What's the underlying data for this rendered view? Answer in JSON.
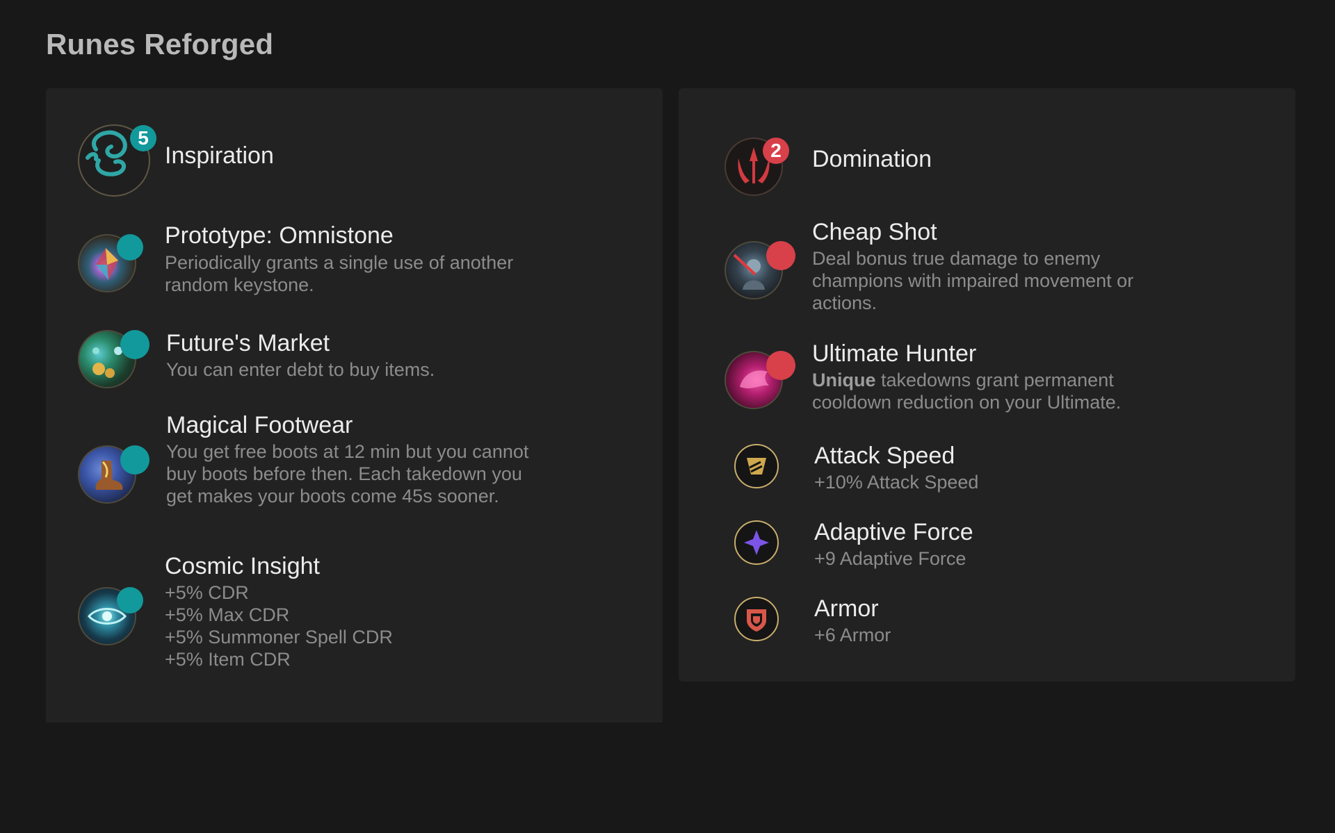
{
  "page": {
    "title": "Runes Reforged"
  },
  "colors": {
    "inspiration": "#12999b",
    "domination": "#d8404a",
    "background": "#181818",
    "panel": "#222222"
  },
  "primary": {
    "tree": {
      "name": "Inspiration",
      "badge": "5",
      "icon": "inspiration-tree-icon"
    },
    "runes": [
      {
        "name": "Prototype: Omnistone",
        "desc": "Periodically grants a single use of another random keystone.",
        "icon": "omnistone-icon"
      },
      {
        "name": "Future's Market",
        "desc": "You can enter debt to buy items.",
        "icon": "futures-market-icon"
      },
      {
        "name": "Magical Footwear",
        "desc": "You get free boots at 12 min but you cannot buy boots before then. Each takedown you get makes your boots come 45s sooner.",
        "icon": "magical-footwear-icon"
      },
      {
        "name": "Cosmic Insight",
        "desc_lines": [
          "+5% CDR",
          "+5% Max CDR",
          "+5% Summoner Spell CDR",
          "+5% Item CDR"
        ],
        "icon": "cosmic-insight-icon"
      }
    ]
  },
  "secondary": {
    "tree": {
      "name": "Domination",
      "badge": "2",
      "icon": "domination-tree-icon"
    },
    "runes": [
      {
        "name": "Cheap Shot",
        "desc": "Deal bonus true damage to enemy champions with impaired movement or actions.",
        "icon": "cheap-shot-icon"
      },
      {
        "name": "Ultimate Hunter",
        "desc_bold": "Unique",
        "desc": " takedowns grant permanent cooldown reduction on your Ultimate.",
        "icon": "ultimate-hunter-icon"
      }
    ],
    "shards": [
      {
        "name": "Attack Speed",
        "desc": "+10% Attack Speed",
        "icon": "attack-speed-icon"
      },
      {
        "name": "Adaptive Force",
        "desc": "+9 Adaptive Force",
        "icon": "adaptive-force-icon"
      },
      {
        "name": "Armor",
        "desc": "+6 Armor",
        "icon": "armor-icon"
      }
    ]
  }
}
